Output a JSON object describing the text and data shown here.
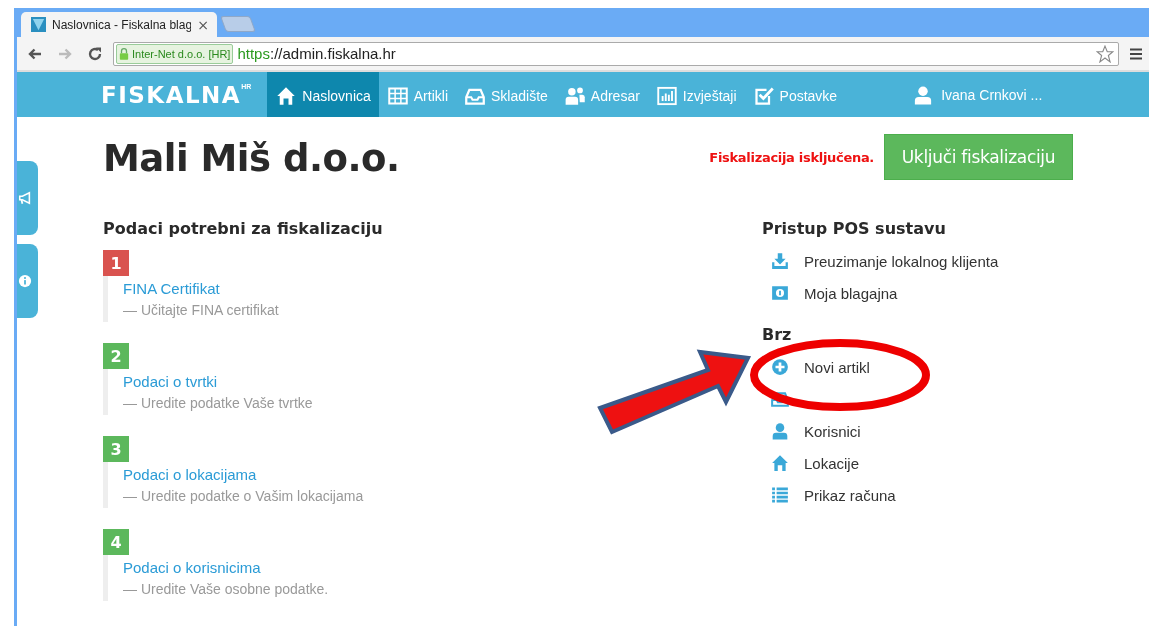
{
  "browser": {
    "tab": {
      "title": "Naslovnica - Fiskalna blag",
      "close": "×"
    },
    "security_badge": "Inter-Net d.o.o. [HR]",
    "url_scheme": "https",
    "url_rest": "://admin.fiskalna.hr"
  },
  "navbar": {
    "logo": "FISKALNA",
    "logo_sup": "HR",
    "user": "Ivana Crnkovi ...",
    "items": [
      {
        "label": "Naslovnica",
        "kind": "home",
        "selected": true
      },
      {
        "label": "Artikli",
        "kind": "table",
        "selected": false
      },
      {
        "label": "Skladište",
        "kind": "inbox",
        "selected": false
      },
      {
        "label": "Adresar",
        "kind": "users",
        "selected": false
      },
      {
        "label": "Izvještaji",
        "kind": "chart",
        "selected": false
      },
      {
        "label": "Postavke",
        "kind": "check",
        "selected": false
      }
    ]
  },
  "side_tabs": [
    {
      "kind": "megaphone"
    },
    {
      "kind": "info"
    }
  ],
  "page": {
    "title": "Mali Miš d.o.o.",
    "status": "Fiskalizacija isključena.",
    "action_button": "Uključi fiskalizaciju"
  },
  "steps": {
    "title": "Podaci potrebni za fiskalizaciju",
    "items": [
      {
        "number": "1",
        "color": "#d9534f",
        "link": "FINA Certifikat",
        "hint": "— Učitajte FINA certifikat"
      },
      {
        "number": "2",
        "color": "#5cb85c",
        "link": "Podaci o tvrtki",
        "hint": "— Uredite podatke Vaše tvrtke"
      },
      {
        "number": "3",
        "color": "#5cb85c",
        "link": "Podaci o lokacijama",
        "hint": "— Uredite podatke o Vašim lokacijama"
      },
      {
        "number": "4",
        "color": "#5cb85c",
        "link": "Podaci o korisnicima",
        "hint": "— Uredite Vaše osobne podatke."
      }
    ]
  },
  "pos": {
    "title": "Pristup POS sustavu",
    "items": [
      {
        "kind": "download",
        "label": "Preuzimanje lokalnog klijenta"
      },
      {
        "kind": "register",
        "label": "Moja blagajna"
      }
    ]
  },
  "quick": {
    "title": "Brz",
    "items": [
      {
        "kind": "plus",
        "label": "Novi artikl"
      },
      {
        "kind": "inbox"
      },
      {
        "kind": "user",
        "label": "Korisnici"
      },
      {
        "kind": "home",
        "label": "Lokacije"
      },
      {
        "kind": "list",
        "label": "Prikaz računa"
      }
    ]
  },
  "annotation": {
    "ellipse": true,
    "arrow": true
  }
}
